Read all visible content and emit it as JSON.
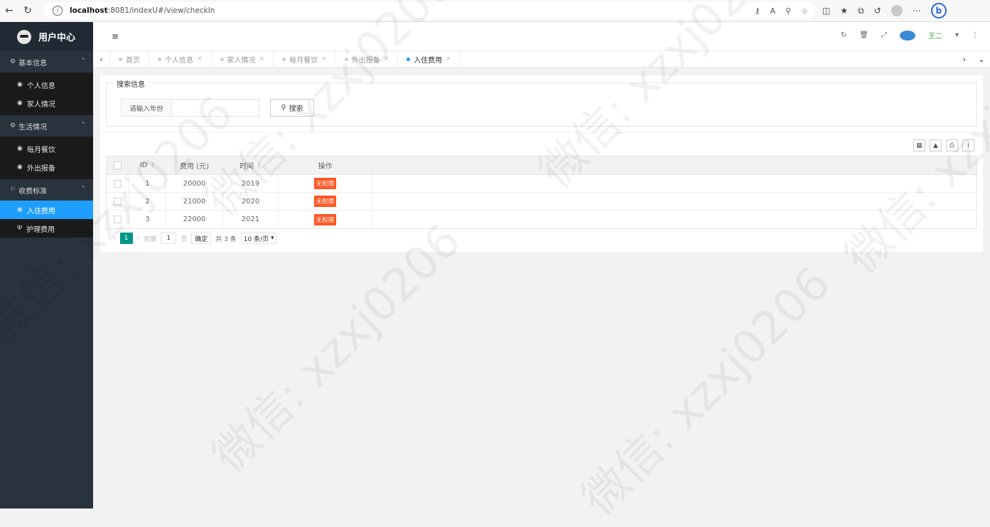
{
  "browser": {
    "url_host": "localhost",
    "url_path": ":8081/indexU#/view/checkIn"
  },
  "sidebar": {
    "title": "用户中心",
    "groups": [
      {
        "label": "基本信息",
        "items": [
          {
            "label": "个人信息"
          },
          {
            "label": "家人情况"
          }
        ]
      },
      {
        "label": "生活情况",
        "items": [
          {
            "label": "每月餐饮"
          },
          {
            "label": "外出报备"
          }
        ]
      },
      {
        "label": "收费标准",
        "items": [
          {
            "label": "入住费用",
            "active": true
          },
          {
            "label": "护理费用"
          }
        ]
      }
    ]
  },
  "header": {
    "user": "王二"
  },
  "tabs": [
    {
      "label": "首页"
    },
    {
      "label": "个人信息"
    },
    {
      "label": "家人情况"
    },
    {
      "label": "每月餐饮"
    },
    {
      "label": "外出报备"
    },
    {
      "label": "入住费用",
      "active": true
    }
  ],
  "search": {
    "legend": "搜索信息",
    "label": "请输入年份",
    "value": "",
    "button": "搜索"
  },
  "table": {
    "columns": [
      "ID",
      "费用 (元)",
      "时间",
      "操作"
    ],
    "rows": [
      {
        "id": "1",
        "fee": "20000",
        "year": "2019",
        "action": "无权限"
      },
      {
        "id": "2",
        "fee": "21000",
        "year": "2020",
        "action": "无权限"
      },
      {
        "id": "3",
        "fee": "22000",
        "year": "2021",
        "action": "无权限"
      }
    ]
  },
  "pager": {
    "current": "1",
    "goto_label": "到第",
    "goto_value": "1",
    "page_unit": "页",
    "confirm": "确定",
    "total": "共 3 条",
    "per_page": "10 条/页"
  },
  "watermark": "微信: xzxj0206",
  "colors": {
    "sidebar": "#28333e",
    "active": "#1e9fff",
    "badge": "#ff5722",
    "pager_current": "#009688"
  }
}
